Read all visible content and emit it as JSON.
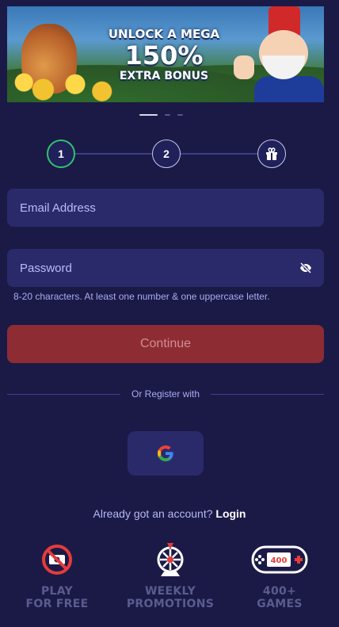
{
  "banner": {
    "line1": "UNLOCK A MEGA",
    "line2": "150%",
    "line3": "EXTRA BONUS"
  },
  "carousel": {
    "count": 3,
    "active": 0
  },
  "stepper": {
    "step1": "1",
    "step2": "2",
    "active_color": "#2ec46a"
  },
  "form": {
    "email_placeholder": "Email Address",
    "password_placeholder": "Password",
    "password_hint": "8-20 characters. At least one number & one uppercase letter.",
    "continue_label": "Continue"
  },
  "social": {
    "divider_text": "Or Register with",
    "google_icon": "google-icon"
  },
  "login": {
    "prompt": "Already got an account?",
    "link": "Login"
  },
  "features": [
    {
      "icon": "no-cash-icon",
      "line1": "PLAY",
      "line2": "FOR FREE"
    },
    {
      "icon": "prize-wheel-icon",
      "line1": "WEEKLY",
      "line2": "PROMOTIONS"
    },
    {
      "icon": "gamepad-icon",
      "line1": "400+",
      "line2": "GAMES",
      "badge": "400"
    }
  ],
  "colors": {
    "background": "#1b1a47",
    "field": "#2a2a6b",
    "continue_button": "#8e2c33",
    "accent_red": "#e53b3b"
  }
}
